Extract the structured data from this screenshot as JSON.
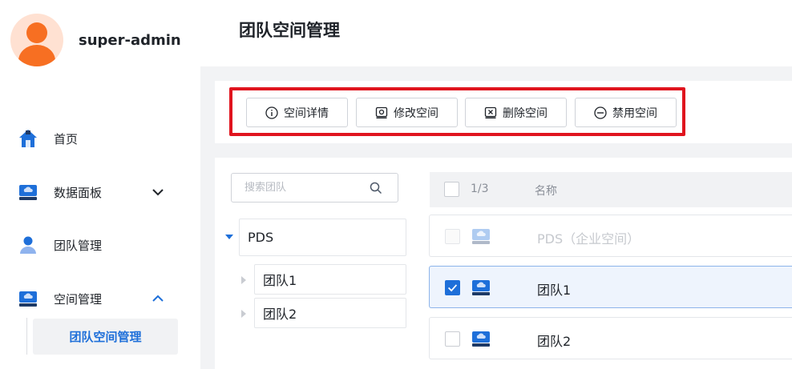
{
  "user": {
    "name": "super-admin"
  },
  "sidebar": {
    "items": [
      {
        "label": "首页"
      },
      {
        "label": "数据面板"
      },
      {
        "label": "团队管理"
      },
      {
        "label": "空间管理"
      }
    ],
    "sub_items": [
      {
        "label": "团队空间管理",
        "active": true
      }
    ]
  },
  "header": {
    "title": "团队空间管理"
  },
  "toolbar": {
    "buttons": [
      {
        "label": "空间详情",
        "icon": "info-icon"
      },
      {
        "label": "修改空间",
        "icon": "edit-drive-icon"
      },
      {
        "label": "删除空间",
        "icon": "delete-drive-icon"
      },
      {
        "label": "禁用空间",
        "icon": "disable-icon"
      }
    ]
  },
  "tree": {
    "search_placeholder": "搜索团队",
    "root": {
      "label": "PDS",
      "expanded": true
    },
    "children": [
      {
        "label": "团队1"
      },
      {
        "label": "团队2"
      }
    ]
  },
  "table": {
    "selection_count": "1/3",
    "column_name": "名称",
    "rows": [
      {
        "name": "PDS（企业空间）",
        "checked": false,
        "disabled": true
      },
      {
        "name": "团队1",
        "checked": true,
        "disabled": false
      },
      {
        "name": "团队2",
        "checked": false,
        "disabled": false
      }
    ]
  },
  "colors": {
    "accent": "#1e6fd9",
    "highlight": "#e0141e",
    "avatar": "#f76f22"
  }
}
